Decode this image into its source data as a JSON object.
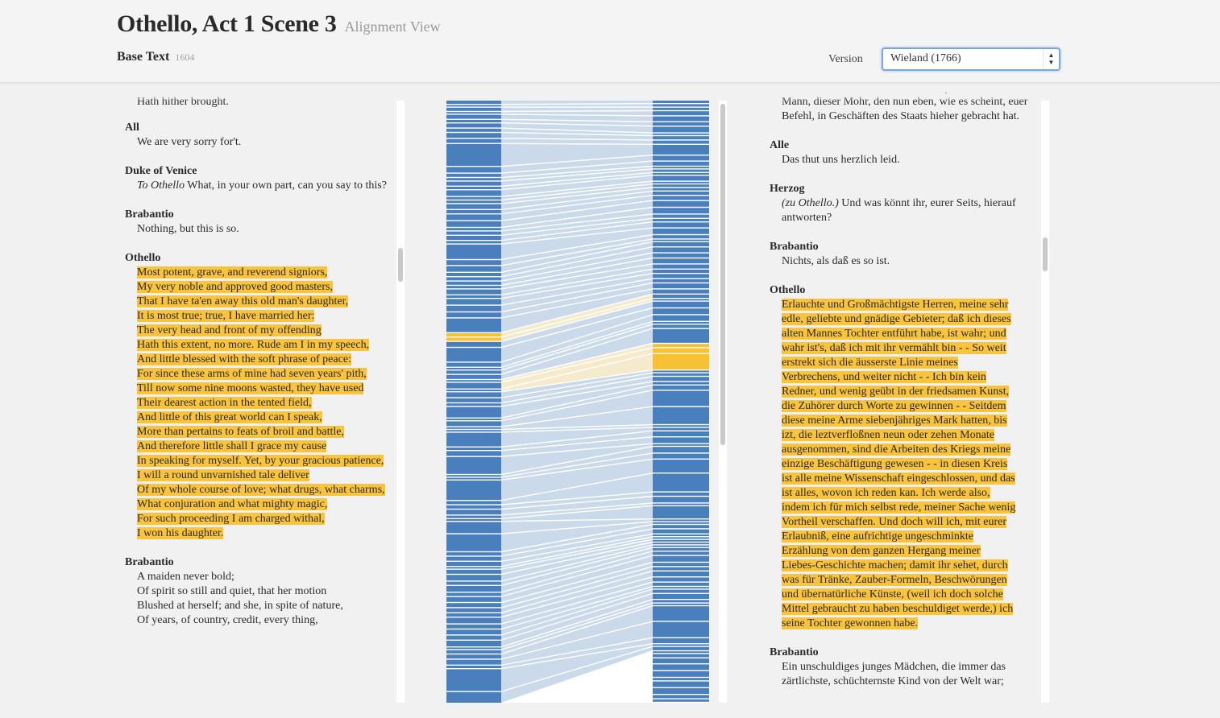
{
  "header": {
    "title": "Othello, Act 1 Scene 3",
    "subtitle": "Alignment View",
    "base_label": "Base Text",
    "base_year": "1604",
    "version_label": "Version",
    "version_value": "Wieland (1766)"
  },
  "left": {
    "partial_line": "Hath hither brought.",
    "speeches": [
      {
        "speaker": "All",
        "lines": [
          "We are very sorry for't."
        ]
      },
      {
        "speaker": "Duke of Venice",
        "stage": "To Othello",
        "lines": [
          "What, in your own part, can you say to this?"
        ]
      },
      {
        "speaker": "Brabantio",
        "lines": [
          "Nothing, but this is so."
        ]
      },
      {
        "speaker": "Othello",
        "highlight": true,
        "lines": [
          "Most potent, grave, and reverend signiors,",
          "My very noble and approved good masters,",
          "That I have ta'en away this old man's daughter,",
          "It is most true; true, I have married her:",
          "The very head and front of my offending",
          "Hath this extent, no more. Rude am I in my speech,",
          "And little blessed with the soft phrase of peace:",
          "For since these arms of mine had seven years' pith,",
          "Till now some nine moons wasted, they have used",
          "Their dearest action in the tented field,",
          "And little of this great world can I speak,",
          "More than pertains to feats of broil and battle,",
          "And therefore little shall I grace my cause",
          "In speaking for myself. Yet, by your gracious patience,",
          "I will a round unvarnished tale deliver",
          "Of my whole course of love; what drugs, what charms,",
          "What conjuration and what mighty magic,",
          "For such proceeding I am charged withal,",
          "I won his daughter."
        ]
      },
      {
        "speaker": "Brabantio",
        "lines": [
          "A maiden never bold;",
          "Of spirit so still and quiet, that her motion",
          "Blushed at herself; and she, in spite of nature,",
          "Of years, of country, credit, every thing,"
        ]
      }
    ]
  },
  "right": {
    "partial_line": "Mann, dieser Mohr, den nun eben, wie es scheint, euer Befehl, in Geschäften des Staats hieher gebracht hat.",
    "speeches": [
      {
        "speaker": "Alle",
        "lines": [
          "Das thut uns herzlich leid."
        ]
      },
      {
        "speaker": "Herzog",
        "stage": "(zu Othello.)",
        "lines": [
          "Und was könnt ihr, eurer Seits, hierauf antworten?"
        ]
      },
      {
        "speaker": "Brabantio",
        "lines": [
          "Nichts, als daß es so ist."
        ]
      },
      {
        "speaker": "Othello",
        "highlight": true,
        "lines": [
          "Erlauchte und Großmächtigste Herren, meine sehr",
          "edle, geliebte und gnädige Gebieter; daß ich dieses",
          "alten Mannes Tochter entführt habe, ist wahr; und",
          "wahr ist's, daß ich mit ihr vermählt bin - - So weit",
          "erstrekt sich die äusserste Linie meines",
          "Verbrechens, und weiter nicht - - Ich bin kein",
          "Redner, und wenig geübt in der friedsamen Kunst,",
          "die Zuhörer durch Worte zu gewinnen - - Seitdem",
          "diese meine Arme siebenjähriges Mark hatten, bis",
          "izt, die leztverfloßnen neun oder zehen Monate",
          "ausgenommen, sind die Arbeiten des Kriegs meine",
          "einzige Beschäftigung gewesen - - in diesen Kreis",
          "ist alle meine Wissenschaft eingeschlossen, und das",
          "ist alles, wovon ich reden kan. Ich werde also,",
          "indem ich für mich selbst rede, meiner Sache wenig",
          "Vortheil verschaffen. Und doch will ich, mit eurer",
          "Erlaubniß, eine aufrichtige ungeschminkte",
          "Erzählung von dem ganzen Hergang meiner",
          "Liebes-Geschichte machen; damit ihr sehet, durch",
          "was für Tränke, Zauber-Formeln, Beschwörungen",
          "und übernatürliche Künste, (weil ich doch solche",
          "Mittel gebraucht zu haben beschuldiget werde,) ich",
          "seine Tochter gewonnen habe."
        ]
      },
      {
        "speaker": "Brabantio",
        "lines": [
          "Ein unschuldiges junges Mädchen, die immer das",
          "zärtlichste, schüchternste Kind von der Welt war;"
        ]
      }
    ]
  },
  "alignment": {
    "colors": {
      "segment": "#4a7fbd",
      "highlight": "#f6c233",
      "link": "#b9cde3",
      "link_highlight": "#f2e4bb",
      "background": "#ffffff"
    }
  }
}
